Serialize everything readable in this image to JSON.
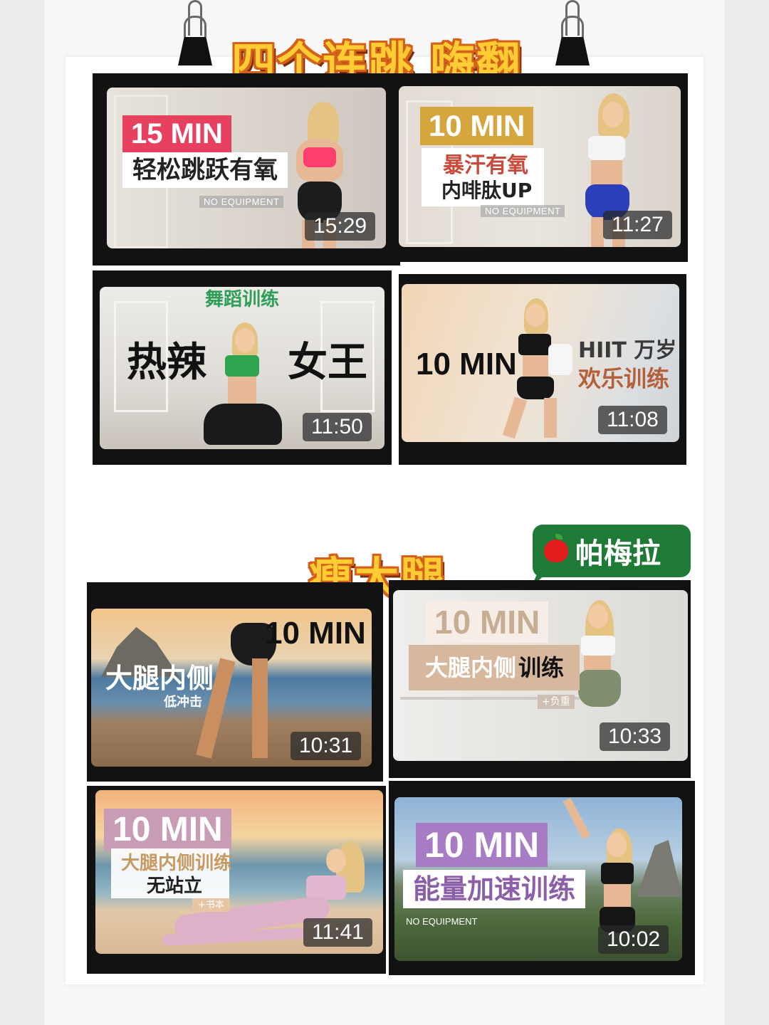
{
  "section1": {
    "title": "四个连跳 嗨翻"
  },
  "section2": {
    "title": "瘦大腿"
  },
  "watermark": {
    "text": "帕梅拉",
    "icon": "apple-icon"
  },
  "videos": [
    {
      "min": "15 MIN",
      "title": "轻松跳跃有氧",
      "tag": "NO EQUIPMENT",
      "duration": "15:29"
    },
    {
      "min": "10 MIN",
      "title1": "暴汗有氧",
      "title2": "内啡肽UP",
      "tag": "NO EQUIPMENT",
      "duration": "11:27"
    },
    {
      "top": "舞蹈训练",
      "left": "热辣",
      "right": "女王",
      "duration": "11:50"
    },
    {
      "min": "10 MIN",
      "title1": "HIIT 万岁",
      "title2": "欢乐训练",
      "duration": "11:08"
    },
    {
      "min": "10 MIN",
      "title1": "大腿内侧",
      "title2": "低冲击",
      "duration": "10:31"
    },
    {
      "min": "10 MIN",
      "title1": "大腿内侧",
      "title2": "训练",
      "tag": "+负重",
      "duration": "10:33"
    },
    {
      "min": "10 MIN",
      "title1": "大腿内侧训练",
      "title2": "无站立",
      "tag": "+书本",
      "duration": "11:41"
    },
    {
      "min": "10 MIN",
      "title": "能量加速训练",
      "tag": "NO EQUIPMENT",
      "duration": "10:02"
    }
  ],
  "colors": {
    "pink_badge": "#e8405f",
    "gold_badge": "#d6a63e",
    "title_fill": "#ffcc33",
    "title_stroke": "#d4601a",
    "watermark_bg": "#1e7a36"
  }
}
